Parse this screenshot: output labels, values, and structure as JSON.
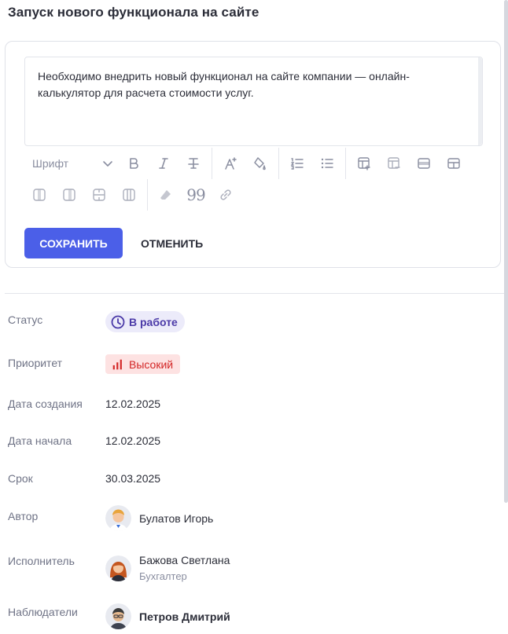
{
  "page": {
    "title": "Запуск нового функционала на сайте"
  },
  "editor": {
    "text": "Необходимо внедрить новый функционал на сайте компании — онлайн-калькулятор для расчета стоимости услуг.",
    "font_select_label": "Шрифт",
    "quote_glyph": "99",
    "save_label": "СОХРАНИТЬ",
    "cancel_label": "ОТМЕНИТЬ"
  },
  "properties": {
    "status": {
      "label": "Статус",
      "value": "В работе",
      "icon": "clock-icon"
    },
    "priority": {
      "label": "Приоритет",
      "value": "Высокий",
      "icon": "bars-chart-icon"
    },
    "created": {
      "label": "Дата создания",
      "value": "12.02.2025"
    },
    "started": {
      "label": "Дата начала",
      "value": "12.02.2025"
    },
    "deadline": {
      "label": "Срок",
      "value": "30.03.2025"
    },
    "author": {
      "label": "Автор",
      "name": "Булатов Игорь"
    },
    "assignee": {
      "label": "Исполнитель",
      "name": "Бажова Светлана",
      "role": "Бухгалтер"
    },
    "watchers": {
      "label": "Наблюдатели",
      "name": "Петров Дмитрий"
    }
  },
  "colors": {
    "primary": "#4b5fe8",
    "status_bg": "#ecebfa",
    "status_text": "#4b3aa8",
    "priority_bg": "#fde2e2",
    "priority_text": "#d32626"
  }
}
